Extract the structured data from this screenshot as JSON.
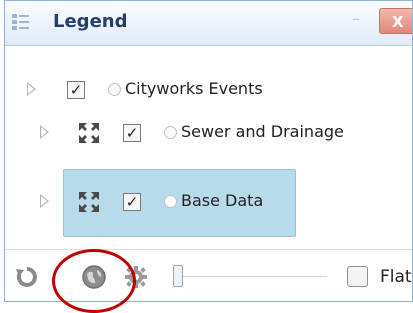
{
  "window": {
    "title": "Legend",
    "title_icon": "legend-icon",
    "minimize_icon": "minimize-icon",
    "minimize_glyph": "–",
    "close_icon": "close-icon",
    "close_glyph": "X"
  },
  "layers": [
    {
      "label": "Cityworks Events",
      "checked": true,
      "check_glyph": "✓",
      "expander_icon": "expand-triangle-icon",
      "full_extent_icon": null,
      "selected": false
    },
    {
      "label": "Sewer and Drainage",
      "checked": true,
      "check_glyph": "✓",
      "expander_icon": "expand-triangle-icon",
      "full_extent_icon": "full-extent-icon",
      "selected": false
    },
    {
      "label": "Base Data",
      "checked": true,
      "check_glyph": "✓",
      "expander_icon": "expand-triangle-icon",
      "full_extent_icon": "full-extent-icon",
      "selected": true
    }
  ],
  "toolbar": {
    "refresh_icon": "refresh-icon",
    "basemap_icon": "globe-icon",
    "settings_icon": "gear-icon",
    "opacity_slider_icon": "slider-thumb",
    "flat_checked": false,
    "flat_label": "Flat"
  },
  "colors": {
    "title_text": "#243f6b",
    "selected_row": "#b8dbeb",
    "close_button": "#e3877a",
    "highlight_circle": "#c00000"
  }
}
